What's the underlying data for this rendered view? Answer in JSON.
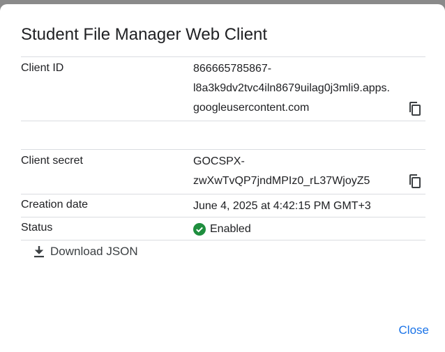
{
  "dialog": {
    "title": "Student File Manager Web Client",
    "rows": {
      "client_id": {
        "label": "Client ID",
        "value_line1": "866665785867-",
        "value_line2": "l8a3k9dv2tvc4iln8679uilag0j3mli9.apps.",
        "value_line3": "googleusercontent.com"
      },
      "client_secret": {
        "label": "Client secret",
        "value_line1": "GOCSPX-",
        "value_line2": "zwXwTvQP7jndMPIz0_rL37WjoyZ5"
      },
      "creation_date": {
        "label": "Creation date",
        "value": "June 4, 2025 at 4:42:15 PM GMT+3"
      },
      "status": {
        "label": "Status",
        "value": "Enabled",
        "icon": "check-circle-icon",
        "icon_color": "#1e8e3e"
      }
    },
    "download_label": "Download JSON",
    "close_label": "Close"
  },
  "colors": {
    "accent": "#1a73e8",
    "divider": "#dadce0",
    "text": "#202124"
  }
}
